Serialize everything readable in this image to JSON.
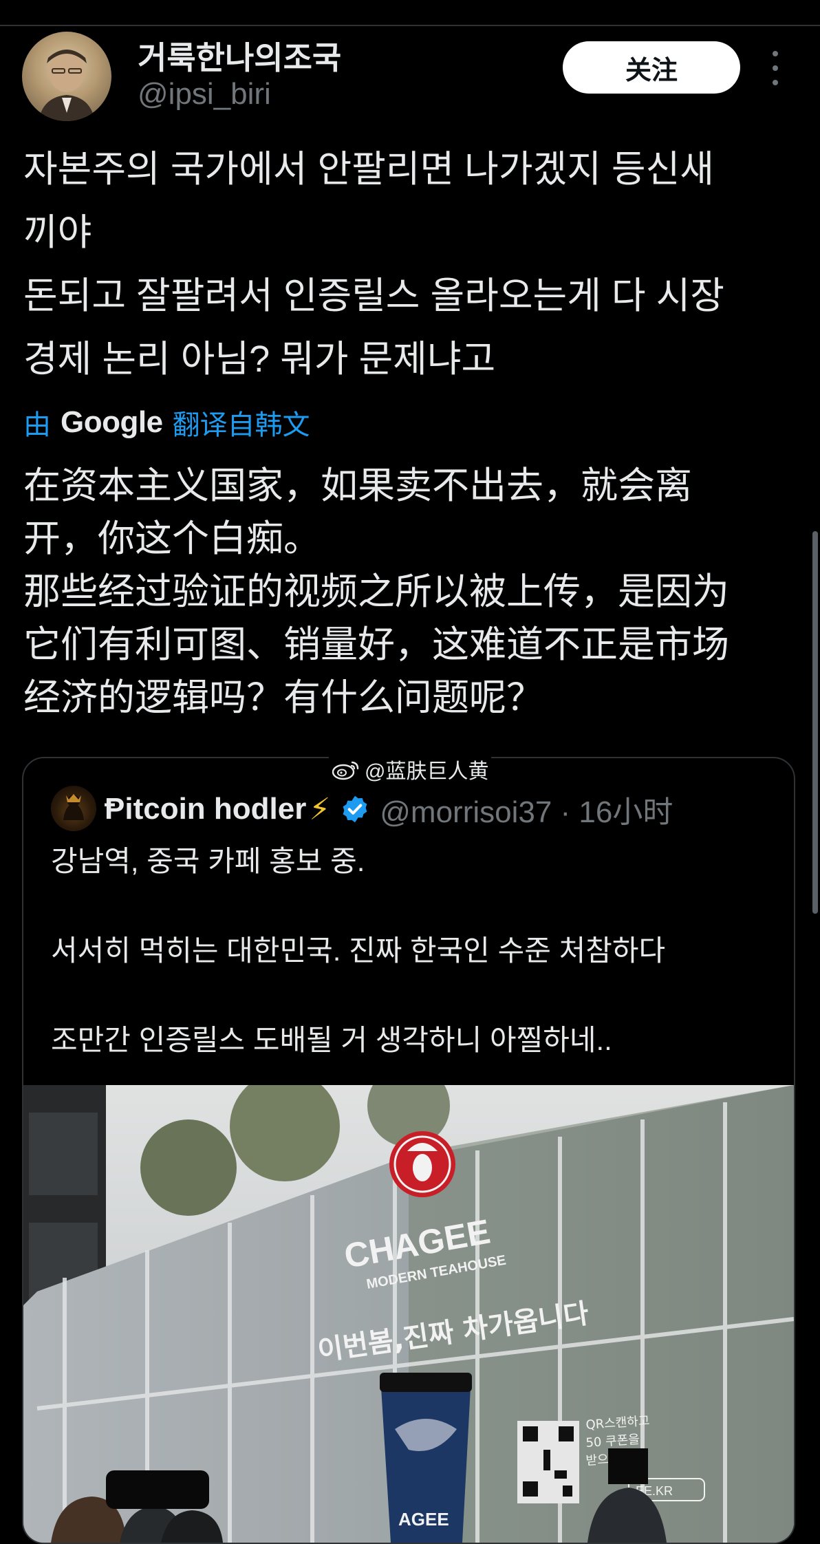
{
  "author": {
    "display_name": "거룩한나의조국",
    "handle": "@ipsi_biri"
  },
  "follow_label": "关注",
  "post_lines": [
    "자본주의 국가에서 안팔리면 나가겠지 등신새",
    "끼야",
    "돈되고 잘팔려서 인증릴스 올라오는게 다 시장",
    "경제 논리 아님? 뭐가 문제냐고"
  ],
  "translate": {
    "prefix": "由",
    "brand": "Google",
    "suffix": "翻译自韩文"
  },
  "translated_lines": [
    "在资本主义国家，如果卖不出去，就会离",
    "开，你这个白痴。",
    "那些经过验证的视频之所以被上传，是因为",
    "它们有利可图、销量好，这难道不正是市场",
    "经济的逻辑吗？有什么问题呢？"
  ],
  "watermark": "@蓝肤巨人黄",
  "quote": {
    "display_name": "Ᵽitcoin hodler",
    "bolt": "⚡",
    "handle_time": "@morrisoi37 · 16小时",
    "paragraphs": [
      "강남역, 중국 카페 홍보 중.",
      "서서히 먹히는 대한민국. 진짜 한국인 수준 처참하다",
      "조만간 인증릴스 도배될 거 생각하니 아찔하네.."
    ]
  },
  "media_text": {
    "brand": "CHAGEE",
    "tagline": "MODERN TEAHOUSE",
    "slogan": "이번봄,진짜 차가옵니다",
    "cup_brand": "AGEE",
    "qr_line1": "QR스캔하고",
    "qr_line2": "50  쿠폰을",
    "qr_line3": "받으세요",
    "qr_url": "EE.KR"
  },
  "colors": {
    "background": "#000000",
    "text": "#e7e9ea",
    "muted": "#71767b",
    "link": "#1d9bf0",
    "verified": "#1d9bf0",
    "brand_red": "#d3202b"
  }
}
